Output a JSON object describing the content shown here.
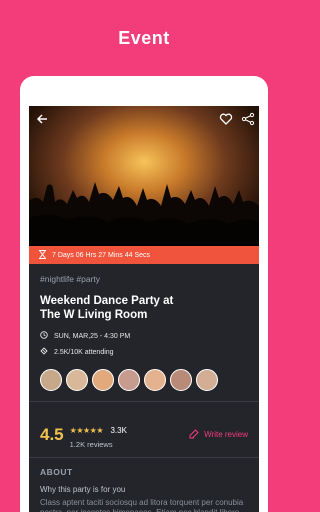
{
  "page": {
    "heading": "Event"
  },
  "hero": {
    "icons": [
      "back-arrow-icon",
      "heart-icon",
      "share-icon"
    ]
  },
  "countdown": {
    "text": "7 Days 06 Hrs 27 Mins 44 Secs",
    "color": "#f0543c"
  },
  "event": {
    "tags": "#nightlife #party",
    "title_line1": "Weekend Dance Party at",
    "title_line2": "The W Living Room",
    "datetime": "SUN, MAR,25 - 4:30 PM",
    "attending": "2.5K/10K attending"
  },
  "attendees": [
    {
      "name": "attendee-1",
      "color": "#c7a88b"
    },
    {
      "name": "attendee-2",
      "color": "#d9b89a"
    },
    {
      "name": "attendee-3",
      "color": "#e2a97c"
    },
    {
      "name": "attendee-4",
      "color": "#c79b8e"
    },
    {
      "name": "attendee-5",
      "color": "#e5b28f"
    },
    {
      "name": "attendee-6",
      "color": "#b88a77"
    },
    {
      "name": "attendee-7",
      "color": "#d3ad94"
    }
  ],
  "rating": {
    "value": "4.5",
    "stars": "★★★★★",
    "count": "3.3K",
    "reviews": "1.2K reviews",
    "write_review": "Write review"
  },
  "about": {
    "heading": "ABOUT",
    "subheading": "Why this party is for you",
    "text": "Class aptent taciti sociosqu ad litora torquent per conubia nostra, per inceptos himenaeos. Etiam nec blandit libero, a viverra mauris et."
  },
  "colors": {
    "accent": "#f23d7a",
    "star": "#f2c14e",
    "background": "#23252b"
  }
}
